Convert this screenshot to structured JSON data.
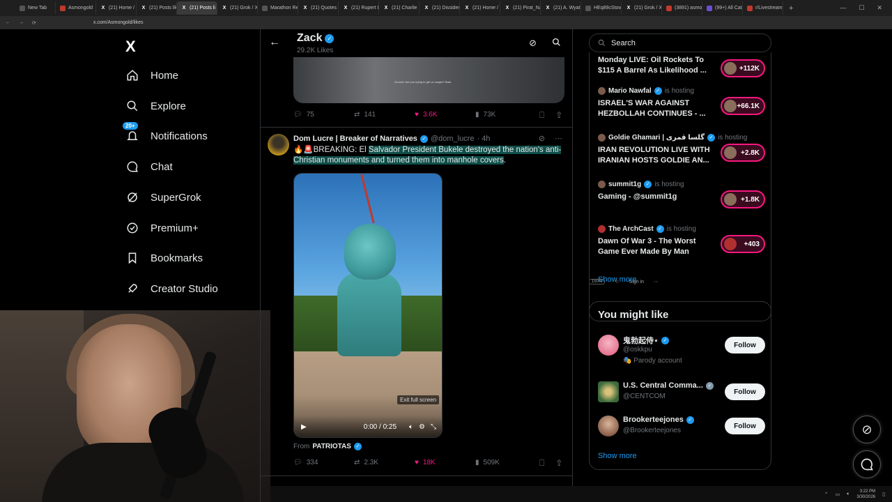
{
  "browser": {
    "tabs": [
      {
        "label": "New Tab",
        "fav": ""
      },
      {
        "label": "Asmongold",
        "fav": "red"
      },
      {
        "label": "(21) Home / X",
        "fav": "x"
      },
      {
        "label": "(21) Posts liked",
        "fav": "x"
      },
      {
        "label": "(21) Posts li",
        "fav": "x",
        "active": true
      },
      {
        "label": "(21) Grok / X",
        "fav": "x"
      },
      {
        "label": "Marathon Re",
        "fav": ""
      },
      {
        "label": "(21) Quotes o",
        "fav": "x"
      },
      {
        "label": "(21) Rupert Lo",
        "fav": "x"
      },
      {
        "label": "(21) Charlie D",
        "fav": "x"
      },
      {
        "label": "(21) Dissident",
        "fav": "x"
      },
      {
        "label": "(21) Home / X",
        "fav": "x"
      },
      {
        "label": "(21) Pirat_Nat",
        "fav": "x"
      },
      {
        "label": "(21) A. Wyatt",
        "fav": "x"
      },
      {
        "label": "HEq89cStowA",
        "fav": ""
      },
      {
        "label": "(21) Grok / X",
        "fav": "x"
      },
      {
        "label": "(3891) asmon",
        "fav": "red"
      },
      {
        "label": "(99+) All Cate",
        "fav": "purple"
      },
      {
        "label": "r/Livestreamfail",
        "fav": "red"
      }
    ],
    "url": "x.com/Asmongold/likes",
    "zoom": "150%",
    "signin": "Sign in"
  },
  "nav": {
    "logo": "X",
    "home": "Home",
    "explore": "Explore",
    "notifications": "Notifications",
    "notif_badge": "20+",
    "chat": "Chat",
    "supergrok": "SuperGrok",
    "premium": "Premium+",
    "bookmarks": "Bookmarks",
    "creator": "Creator Studio"
  },
  "profile": {
    "name": "Zack",
    "likes": "29.2K Likes"
  },
  "prev_tweet": {
    "caption": "Ground. Are you trying to get us caught? Bark.",
    "replies": "75",
    "reposts": "141",
    "likes": "3.6K",
    "views": "73K"
  },
  "tweet": {
    "name": "Dom Lucre | Breaker of Narratives",
    "handle": "@dom_lucre",
    "time": "· 4h",
    "text_prefix": "🔥🚨BREAKING: El ",
    "text_highlight": "Salvador President Bukele destroyed the nation's anti-Christian monuments and turned them into manhole covers",
    "text_suffix": ".",
    "video_time": "0:00 / 0:25",
    "exit_fullscreen": "Exit full screen",
    "from_label": "From",
    "from_source": "PATRIOTAS",
    "replies": "334",
    "reposts": "2.3K",
    "likes": "18K",
    "views": "509K"
  },
  "search": {
    "placeholder": "Search"
  },
  "spaces": [
    {
      "host": "",
      "hosting": "",
      "title": "Monday LIVE: Oil Rockets To $115 A Barrel As Likelihood ...",
      "count": "+112K"
    },
    {
      "host": "Mario Nawfal",
      "hosting": "is hosting",
      "title": "ISRAEL'S WAR AGAINST HEZBOLLAH CONTINUES - ...",
      "count": "+66.1K"
    },
    {
      "host": "Goldie Ghamari | گلسا قمری",
      "hosting": "is hosting",
      "title": "IRAN REVOLUTION LIVE WITH IRANIAN HOSTS GOLDIE AN...",
      "count": "+2.8K"
    },
    {
      "host": "summit1g",
      "hosting": "is hosting",
      "title": "Gaming - @summit1g",
      "count": "+1.8K"
    },
    {
      "host": "The ArchCast",
      "hosting": "is hosting",
      "title": "Dawn Of War 3 - The Worst Game Ever Made By Man",
      "count": "+403"
    }
  ],
  "spaces_show_more": "Show more",
  "might_like": {
    "title": "You might like",
    "users": [
      {
        "name": "鬼勃起侍⋆",
        "handle": "@oskkpu",
        "note": "🎭 Parody account",
        "button": "Follow"
      },
      {
        "name": "U.S. Central Comma...",
        "handle": "@CENTCOM",
        "note": "",
        "button": "Follow"
      },
      {
        "name": "Brookerteejones",
        "handle": "@Brookerteejones",
        "note": "",
        "button": "Follow"
      }
    ],
    "show_more": "Show more"
  },
  "clock": {
    "time": "3:22 PM",
    "date": "3/30/2026"
  },
  "colors": {
    "accent": "#1d9bf0",
    "like": "#f91880",
    "bg": "#000000"
  }
}
